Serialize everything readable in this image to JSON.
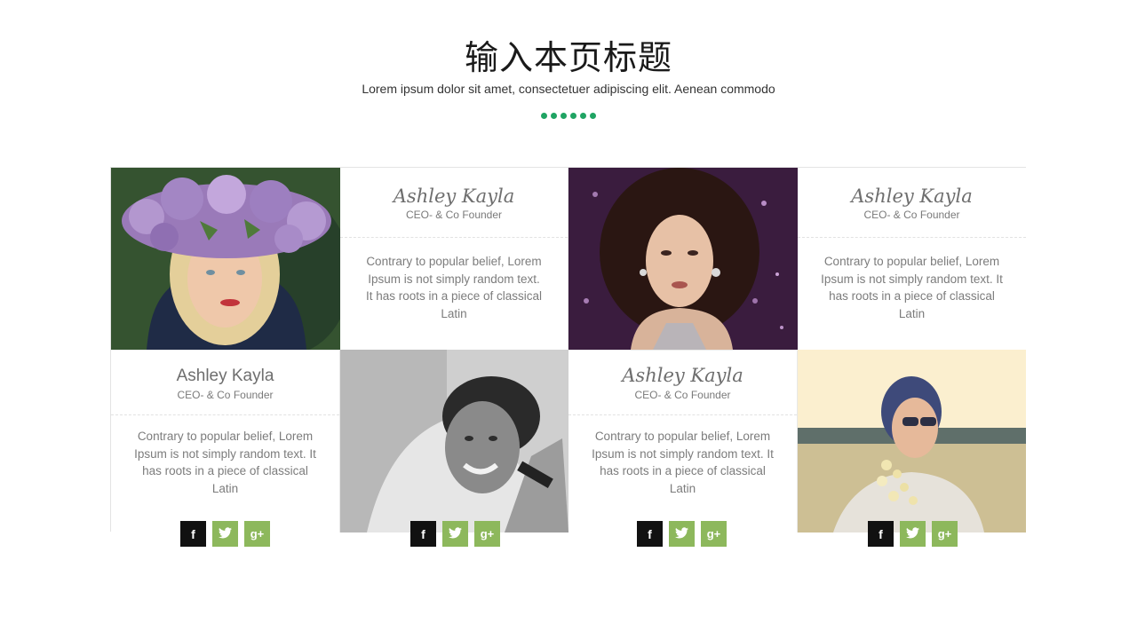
{
  "header": {
    "title": "输入本页标题",
    "subtitle": "Lorem ipsum dolor sit amet, consectetuer adipiscing elit. Aenean commodo",
    "accent_color": "#1fa463"
  },
  "members": [
    {
      "name": "Ashley Kayla",
      "role": "CEO- & Co Founder",
      "description": "Contrary to popular belief, Lorem Ipsum is not simply random text. It has roots in a piece of classical Latin",
      "photo": "woman-flower-crown-photo"
    },
    {
      "name": "Ashley Kayla",
      "role": "CEO- & Co Founder",
      "description": "Contrary to popular belief, Lorem Ipsum is not simply random text. It has roots in a piece of classical Latin",
      "photo": "woman-curly-hair-photo"
    },
    {
      "name": "Ashley Kayla",
      "role": "CEO- & Co Founder",
      "description": "Contrary to popular belief, Lorem Ipsum is not simply random text. It has roots in a piece of classical Latin",
      "photo": "man-smiling-bw-photo"
    },
    {
      "name": "Ashley Kayla",
      "role": "CEO- & Co Founder",
      "description": "Contrary to popular belief, Lorem Ipsum is not simply random text. It has roots in a piece of classical Latin",
      "photo": "woman-sunglasses-field-photo"
    }
  ],
  "social": {
    "facebook_glyph": "f",
    "twitter_glyph": "t",
    "googleplus_glyph": "g+",
    "facebook_color": "#111111",
    "twitter_color": "#8db85c",
    "googleplus_color": "#8db85c"
  }
}
